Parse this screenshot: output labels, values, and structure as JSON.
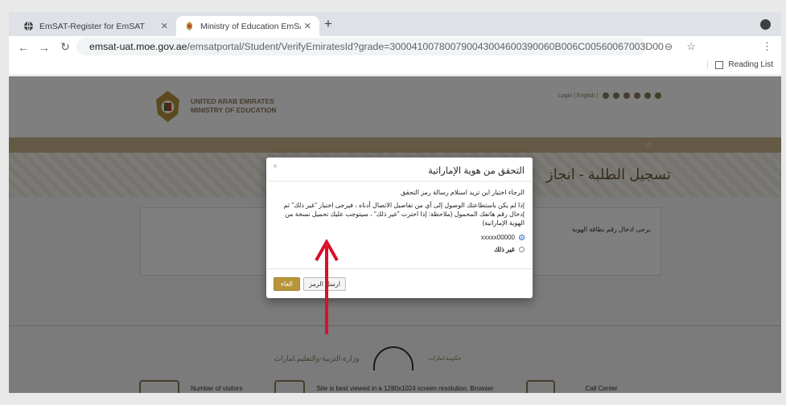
{
  "browser": {
    "tabs": [
      {
        "title": "EmSAT-Register for EmSAT",
        "icon": "globe-icon",
        "active": false
      },
      {
        "title": "Ministry of Education EmSAT -",
        "icon": "uae-emblem-icon",
        "active": true
      }
    ],
    "new_tab_label": "+",
    "url_host": "emsat-uat.moe.gov.ae",
    "url_path": "/emsatportal/Student/VerifyEmiratesId?grade=300041007800790043004600390060B006C00560067003D00",
    "reading_list_label": "Reading List"
  },
  "site": {
    "org_line1": "UNITED ARAB EMIRATES",
    "org_line2": "MINISTRY OF EDUCATION",
    "top_links": "Login | English |",
    "page_title": "تسجيل الطلبة - انجاز",
    "id_hint": "يرجى ادخال رقم بطاقة الهوية",
    "footer_moe": "وزارة-التربية-والتعليم.امارات",
    "footer_gov": "حكومة.امارات",
    "visitors_label": "Number of visitors",
    "resolution_note": "Site is best viewed in a 1280x1024 screen resolution. Browser",
    "call_center_label": "Call Center"
  },
  "modal": {
    "title": "التحقق من هوية الإماراتية",
    "question": "الرجاء اختيار اين تريد استلام رسالة رمز التحقق",
    "explanation": "إذا لم يكن باستطاعتك الوصول إلى أي من تفاصيل الاتصال أدناه ، فيرجى اختيار \"غير ذلك\" ثم إدخال رقم هاتفك المحمول (ملاحظة: إذا اخترت \"غير ذلك\" ، سيتوجب عليك تحميل نسخة من الهوية الإماراتية)",
    "option_phone": "xxxxx00000",
    "option_other": "غير ذلك",
    "selected": "option_phone",
    "send_label": "ارسل الرمز",
    "cancel_label": "الغاء",
    "close_label": "×"
  },
  "annotation": {
    "arrow_color": "#d8102a"
  },
  "colors": {
    "gold": "#b8943c",
    "accent_blue": "#2f6fcf"
  }
}
